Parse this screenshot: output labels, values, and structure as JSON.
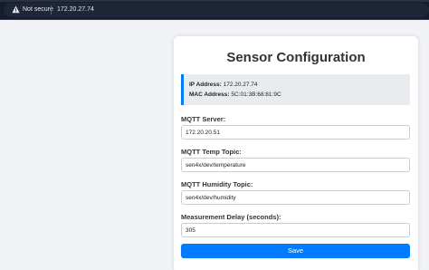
{
  "browser": {
    "security_label": "Not secure",
    "url": "172.20.27.74"
  },
  "page": {
    "title": "Sensor Configuration",
    "info": {
      "ip_label": "IP Address:",
      "ip_value": "172.20.27.74",
      "mac_label": "MAC Address:",
      "mac_value": "5C:01:3B:68:81:9C"
    },
    "fields": {
      "mqtt_server": {
        "label": "MQTT Server:",
        "value": "172.20.20.51"
      },
      "temp_topic": {
        "label": "MQTT Temp Topic:",
        "value": "sen4x/dev/temperature"
      },
      "humidity_topic": {
        "label": "MQTT Humidity Topic:",
        "value": "sen4x/dev/humidity"
      },
      "delay": {
        "label": "Measurement Delay (seconds):",
        "value": "305"
      }
    },
    "save_label": "Save"
  },
  "colors": {
    "accent": "#007bff",
    "browser_bar": "#151c2b",
    "page_bg": "#f1f2f6"
  }
}
